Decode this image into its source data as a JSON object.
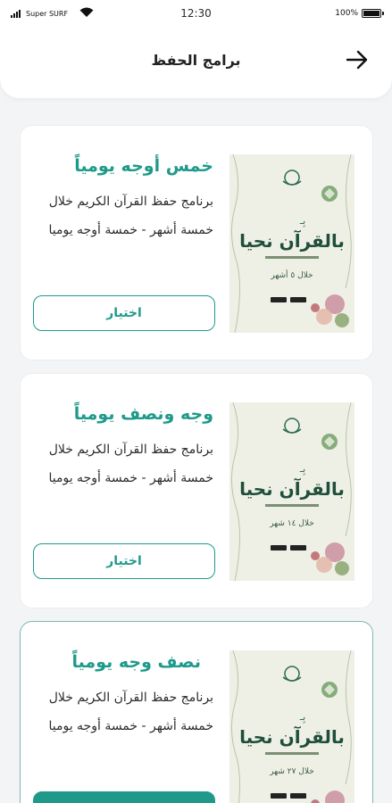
{
  "status_bar": {
    "carrier": "Super SURF",
    "time": "12:30",
    "battery": "100%",
    "battery_level": 1.0
  },
  "header": {
    "title": "برامج الحفظ"
  },
  "programs": [
    {
      "title": "خمس أوجه يومياً",
      "description": "برنامج حفظ القرآن الكريم خلال خمسة أشهر - خمسة أوجه يوميا",
      "button_label": "اختيار",
      "poster": {
        "heading": "بالقرآن نحيا",
        "duration_label": "خلال ٥ أشهر"
      }
    },
    {
      "title": "وجه ونصف يومياً",
      "description": "برنامج حفظ القرآن الكريم خلال خمسة أشهر - خمسة أوجه يوميا",
      "button_label": "اختيار",
      "poster": {
        "heading": "بالقرآن نحيا",
        "duration_label": "خلال ١٤ شهر"
      }
    },
    {
      "title": "نصف وجه يومياً",
      "description": "برنامج حفظ القرآن الكريم خلال خمسة أشهر - خمسة أوجه يوميا",
      "button_label": "",
      "poster": {
        "heading": "بالقرآن نحيا",
        "duration_label": "خلال ٢٧ شهر"
      }
    }
  ],
  "colors": {
    "accent": "#1f9a8a",
    "selected_border": "#7fb8ad",
    "background": "#f3f4f5"
  }
}
